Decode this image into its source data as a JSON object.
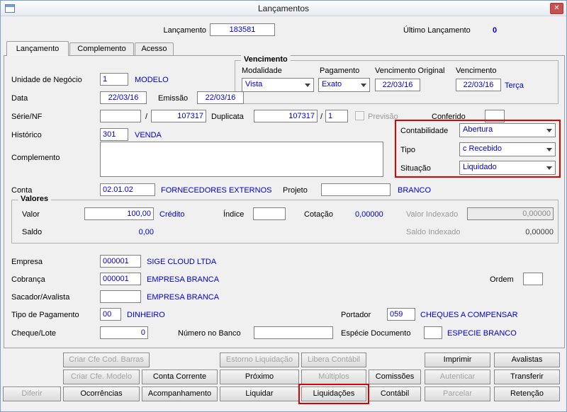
{
  "window": {
    "title": "Lançamentos",
    "close_glyph": "✕"
  },
  "header": {
    "lancamento_label": "Lançamento",
    "lancamento_value": "183581",
    "ultimo_label": "Último Lançamento",
    "ultimo_value": "0"
  },
  "tabs": [
    {
      "label": "Lançamento"
    },
    {
      "label": "Complemento"
    },
    {
      "label": "Acesso"
    }
  ],
  "form": {
    "unidade": {
      "label": "Unidade de Negócio",
      "value": "1",
      "desc": "MODELO"
    },
    "vencimento_group": {
      "title": "Vencimento",
      "modalidade_label": "Modalidade",
      "modalidade_value": "Vista",
      "pagamento_label": "Pagamento",
      "pagamento_value": "Exato",
      "vencimento_original_label": "Vencimento Original",
      "vencimento_original_value": "22/03/16",
      "vencimento_label": "Vencimento",
      "vencimento_value": "22/03/16",
      "vencimento_desc": "Terça"
    },
    "data": {
      "label": "Data",
      "value": "22/03/16"
    },
    "emissao": {
      "label": "Emissão",
      "value": "22/03/16"
    },
    "serie_nf": {
      "label": "Série/NF",
      "value1": "",
      "sep": "/",
      "value2": "107317"
    },
    "duplicata": {
      "label": "Duplicata",
      "value1": "107317",
      "sep": "/",
      "value2": "1"
    },
    "previsao_label": "Previsão",
    "conferido": {
      "label": "Conferido",
      "value": ""
    },
    "historico": {
      "label": "Histórico",
      "value": "301",
      "desc": "VENDA"
    },
    "contabilidade": {
      "label": "Contabilidade",
      "value": "Abertura"
    },
    "tipo": {
      "label": "Tipo",
      "value": "c Recebido"
    },
    "situacao": {
      "label": "Situação",
      "value": "Liquidado"
    },
    "complemento_label": "Complemento",
    "conta": {
      "label": "Conta",
      "value": "02.01.02",
      "desc": "FORNECEDORES EXTERNOS"
    },
    "projeto": {
      "label": "Projeto",
      "value": "",
      "desc": "BRANCO"
    },
    "valores_group": {
      "title": "Valores",
      "valor_label": "Valor",
      "valor_value": "100,00",
      "valor_desc": "Crédito",
      "indice_label": "Índice",
      "indice_value": "",
      "cotacao_label": "Cotação",
      "cotacao_value": "0,00000",
      "valor_indexado_label": "Valor Indexado",
      "valor_indexado_value": "0,00000",
      "saldo_label": "Saldo",
      "saldo_value": "0,00",
      "saldo_indexado_label": "Saldo Indexado",
      "saldo_indexado_value": "0,00000"
    },
    "empresa": {
      "label": "Empresa",
      "value": "000001",
      "desc": "SIGE CLOUD LTDA"
    },
    "cobranca": {
      "label": "Cobrança",
      "value": "000001",
      "desc": "EMPRESA BRANCA"
    },
    "ordem": {
      "label": "Ordem",
      "value": ""
    },
    "sacador": {
      "label": "Sacador/Avalista",
      "value": "",
      "desc": "EMPRESA BRANCA"
    },
    "tipo_pagamento": {
      "label": "Tipo de Pagamento",
      "value": "00",
      "desc": "DINHEIRO"
    },
    "portador": {
      "label": "Portador",
      "value": "059",
      "desc": "CHEQUES A COMPENSAR"
    },
    "cheque_lote": {
      "label": "Cheque/Lote",
      "value": "0"
    },
    "numero_banco": {
      "label": "Número no Banco",
      "value": ""
    },
    "especie": {
      "label": "Espécie Documento",
      "value": "",
      "desc": "ESPECIE BRANCO"
    }
  },
  "buttons": {
    "criar_cfe_cod_barras": "Criar Cfe Cod. Barras",
    "estorno_liquidacao": "Estorno Liquidação",
    "libera_contabil": "Libera Contábil",
    "imprimir": "Imprimir",
    "avalistas": "Avalistas",
    "criar_cfe_modelo": "Criar Cfe. Modelo",
    "conta_corrente": "Conta Corrente",
    "proximo": "Próximo",
    "multiplos": "Múltiplos",
    "comissoes": "Comissões",
    "autenticar": "Autenticar",
    "transferir": "Transferir",
    "diferir": "Diferir",
    "ocorrencias": "Ocorrências",
    "acompanhamento": "Acompanhamento",
    "liquidar": "Liquidar",
    "liquidacoes": "Liquidações",
    "contabil": "Contábil",
    "parcelar": "Parcelar",
    "retencao": "Retenção"
  },
  "colors": {
    "value_blue": "#0000d8",
    "highlight_red": "#e00000",
    "close_red": "#c75050"
  }
}
